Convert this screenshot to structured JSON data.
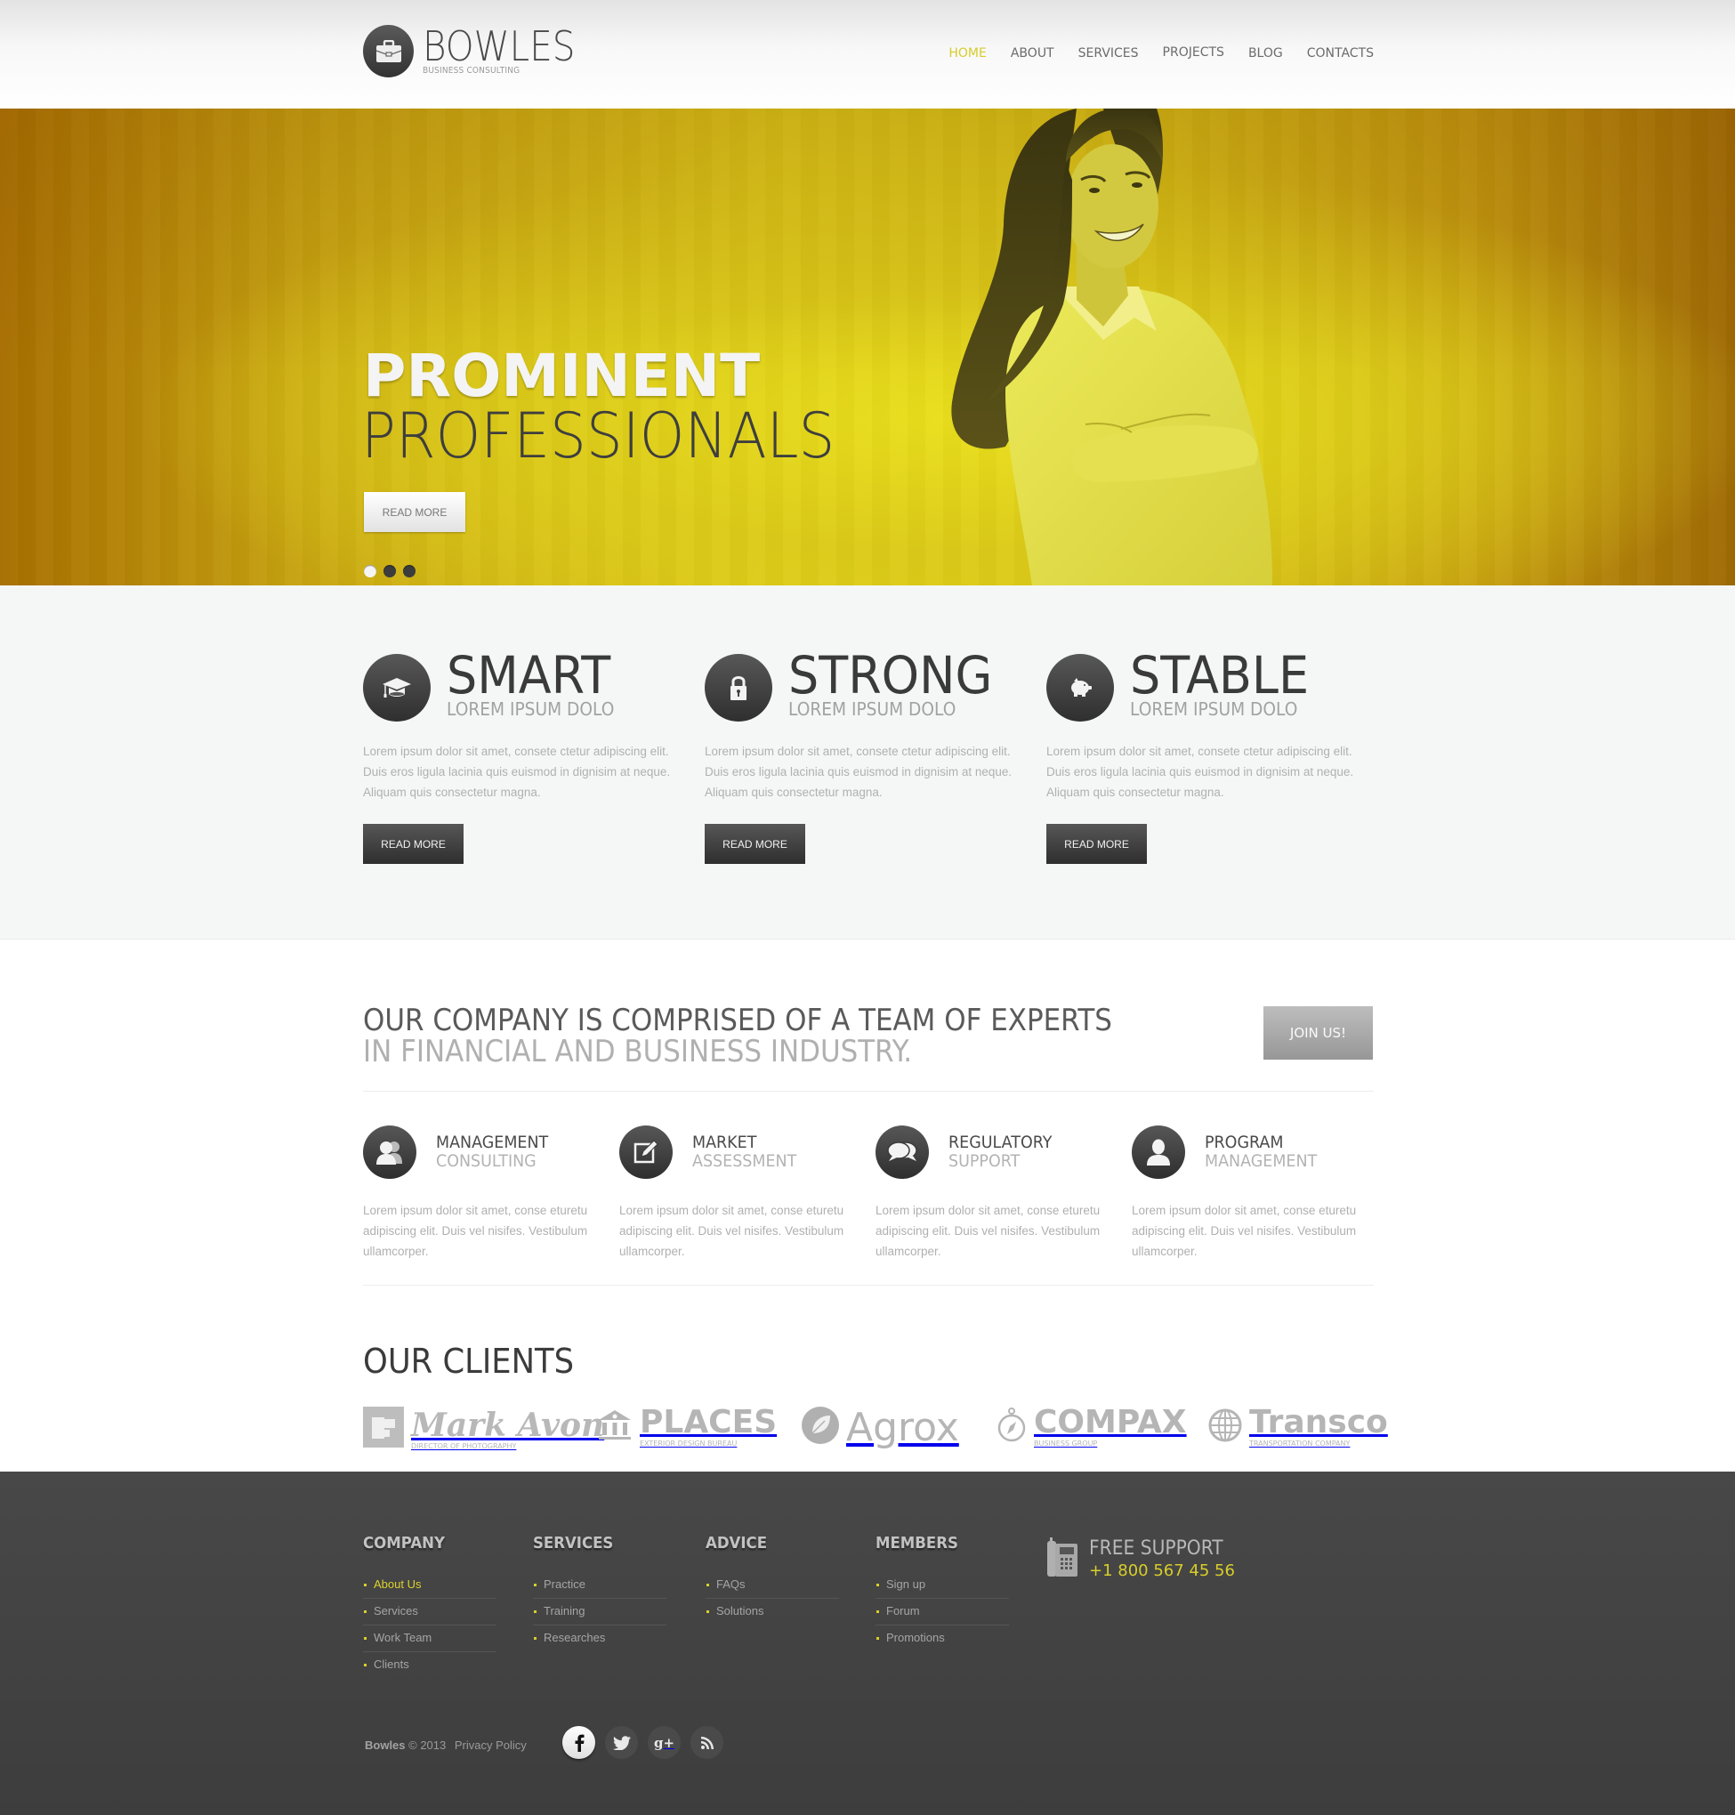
{
  "header": {
    "brand": "BOWLES",
    "tagline": "BUSINESS CONSULTING",
    "logo_icon": "briefcase-icon",
    "nav": [
      {
        "label": "HOME",
        "active": true
      },
      {
        "label": "ABOUT",
        "active": false
      },
      {
        "label": "SERVICES",
        "active": false
      },
      {
        "label": "PROJECTS",
        "active": false
      },
      {
        "label": "BLOG",
        "active": false
      },
      {
        "label": "CONTACTS",
        "active": false
      }
    ]
  },
  "hero": {
    "title_line1": "PROMINENT",
    "title_line2": "PROFESSIONALS",
    "button_label": "READ MORE",
    "slides_total": 3,
    "active_slide": 1
  },
  "features": [
    {
      "title": "SMART",
      "subtitle": "LOREM IPSUM DOLO",
      "icon": "graduation-cap-icon",
      "body": "Lorem ipsum dolor sit amet, consete ctetur adipiscing elit. Duis eros ligula lacinia quis euismod in dignisim at neque. Aliquam quis consectetur magna.",
      "button": "READ MORE"
    },
    {
      "title": "STRONG",
      "subtitle": "LOREM IPSUM DOLO",
      "icon": "padlock-icon",
      "body": "Lorem ipsum dolor sit amet, consete ctetur adipiscing elit. Duis eros ligula lacinia quis euismod in dignisim at neque. Aliquam quis consectetur magna.",
      "button": "READ MORE"
    },
    {
      "title": "STABLE",
      "subtitle": "LOREM IPSUM DOLO",
      "icon": "piggy-bank-icon",
      "body": "Lorem ipsum dolor sit amet, consete ctetur adipiscing elit. Duis eros ligula lacinia quis euismod in dignisim at neque. Aliquam quis consectetur magna.",
      "button": "READ MORE"
    }
  ],
  "about": {
    "headline_line1": "OUR COMPANY IS COMPRISED OF A TEAM OF EXPERTS",
    "headline_line2": "IN FINANCIAL AND BUSINESS INDUSTRY.",
    "join_button": "JOIN US!",
    "services": [
      {
        "title1": "MANAGEMENT",
        "title2": "CONSULTING",
        "icon": "users-icon",
        "body": "Lorem ipsum dolor sit amet, conse eturetu adipiscing elit. Duis vel nisifes. Vestibulum ullamcorper."
      },
      {
        "title1": "MARKET",
        "title2": "ASSESSMENT",
        "icon": "edit-icon",
        "body": "Lorem ipsum dolor sit amet, conse eturetu adipiscing elit. Duis vel nisifes. Vestibulum ullamcorper."
      },
      {
        "title1": "REGULATORY",
        "title2": "SUPPORT",
        "icon": "chat-bubbles-icon",
        "body": "Lorem ipsum dolor sit amet, conse eturetu adipiscing elit. Duis vel nisifes. Vestibulum ullamcorper."
      },
      {
        "title1": "PROGRAM",
        "title2": "MANAGEMENT",
        "icon": "user-icon",
        "body": "Lorem ipsum dolor sit amet, conse eturetu adipiscing elit. Duis vel nisifes. Vestibulum ullamcorper."
      }
    ]
  },
  "clients": {
    "heading": "OUR CLIENTS",
    "logos": [
      {
        "name": "Mark Avon",
        "sub": "DIRECTOR OF PHOTOGRAPHY",
        "icon": "film-icon"
      },
      {
        "name": "PLACES",
        "sub": "EXTERIOR DESIGN BUREAU",
        "icon": "bank-icon"
      },
      {
        "name": "Agrox",
        "sub": "",
        "icon": "leaf-icon"
      },
      {
        "name": "COMPAX",
        "sub": "BUSINESS GROUP",
        "icon": "compass-icon"
      },
      {
        "name": "Transco",
        "sub": "TRANSPORTATION COMPANY",
        "icon": "globe-icon"
      }
    ]
  },
  "footer": {
    "columns": [
      {
        "heading": "COMPANY",
        "links": [
          "About Us",
          "Services",
          "Work Team",
          "Clients"
        ],
        "active_index": 0
      },
      {
        "heading": "SERVICES",
        "links": [
          "Practice",
          "Training",
          "Researches"
        ],
        "active_index": -1
      },
      {
        "heading": "ADVICE",
        "links": [
          "FAQs",
          "Solutions"
        ],
        "active_index": -1
      },
      {
        "heading": "MEMBERS",
        "links": [
          "Sign up",
          "Forum",
          "Promotions"
        ],
        "active_index": -1
      }
    ],
    "support": {
      "title": "FREE SUPPORT",
      "phone": "+1 800 567 45 56",
      "icon": "phone-icon"
    },
    "copyright_brand": "Bowles",
    "copyright_text": "© 2013",
    "privacy_link": "Privacy Policy",
    "social": [
      {
        "name": "facebook",
        "icon": "facebook-icon",
        "active": true
      },
      {
        "name": "twitter",
        "icon": "twitter-icon",
        "active": false
      },
      {
        "name": "google-plus",
        "icon": "google-plus-icon",
        "active": false
      },
      {
        "name": "rss",
        "icon": "rss-icon",
        "active": false
      }
    ]
  },
  "colors": {
    "accent": "#d7cc2c",
    "hero_yellow": "#e0cf1a",
    "hero_amber": "#a86f00",
    "dark": "#3a3a3a",
    "footer_bg": "#434343"
  }
}
